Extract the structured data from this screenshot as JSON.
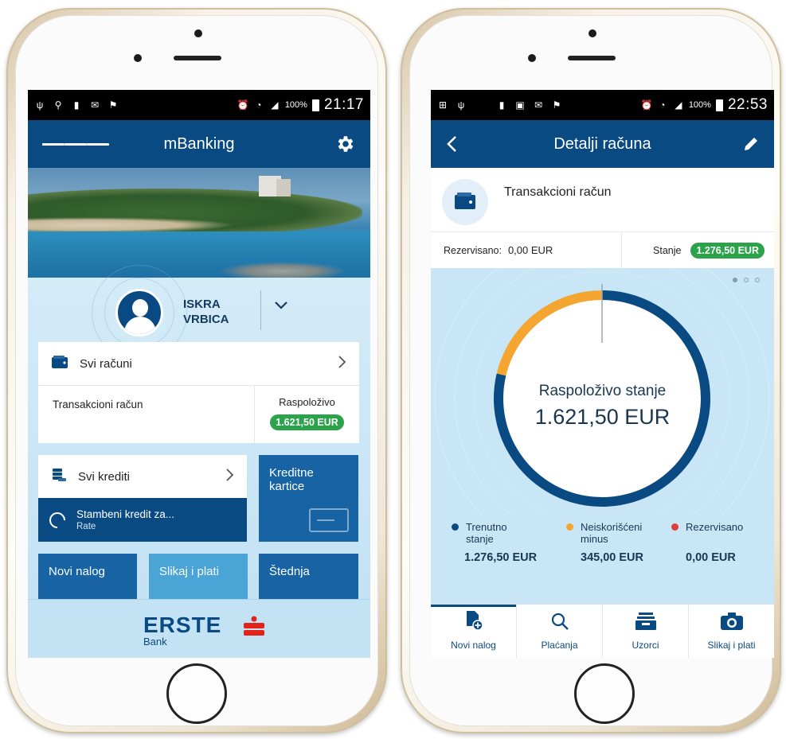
{
  "left_screen": {
    "status": {
      "battery": "100%",
      "time": "21:17"
    },
    "header": {
      "title": "mBanking"
    },
    "profile": {
      "first_name": "ISKRA",
      "last_name": "VRBICA"
    },
    "accounts": {
      "title": "Svi računi",
      "account_name": "Transakcioni račun",
      "available_label": "Raspoloživo",
      "available_value": "1.621,50 EUR"
    },
    "credits": {
      "title": "Svi krediti",
      "item_title": "Stambeni kredit za...",
      "item_sub": "Rate"
    },
    "tiles": {
      "cards": "Kreditne kartice",
      "new_order": "Novi nalog",
      "photo_pay": "Slikaj i plati",
      "savings": "Štednja"
    },
    "footer": {
      "brand": "ERSTE",
      "sub": "Bank"
    }
  },
  "right_screen": {
    "status": {
      "battery": "100%",
      "time": "22:53"
    },
    "header": {
      "title": "Detalji računa"
    },
    "account": {
      "title": "Transakcioni račun",
      "reserved_label": "Rezervisano:",
      "reserved_value": "0,00 EUR",
      "balance_label": "Stanje",
      "balance_value": "1.276,50 EUR"
    },
    "chart": {
      "center_label": "Raspoloživo stanje",
      "center_value": "1.621,50 EUR",
      "legend": [
        {
          "label_line1": "Trenutno",
          "label_line2": "stanje",
          "value": "1.276,50 EUR",
          "color": "#0a4a82"
        },
        {
          "label_line1": "Neiskorišćeni",
          "label_line2": "minus",
          "value": "345,00 EUR",
          "color": "#f4a630"
        },
        {
          "label_line1": "Rezervisano",
          "label_line2": "",
          "value": "0,00 EUR",
          "color": "#e23b3b"
        }
      ]
    },
    "tabs": [
      {
        "label": "Novi nalog",
        "icon": "new-document-icon"
      },
      {
        "label": "Plaćanja",
        "icon": "search-icon"
      },
      {
        "label": "Uzorci",
        "icon": "inbox-tray-icon"
      },
      {
        "label": "Slikaj i plati",
        "icon": "camera-icon"
      }
    ]
  },
  "chart_data": {
    "type": "pie",
    "categories": [
      "Trenutno stanje",
      "Neiskorišćeni minus",
      "Rezervisano"
    ],
    "values": [
      1276.5,
      345.0,
      0.0
    ],
    "total_label": "Raspoloživo stanje",
    "total_value": 1621.5,
    "colors": [
      "#0a4a82",
      "#f4a630",
      "#e23b3b"
    ]
  }
}
